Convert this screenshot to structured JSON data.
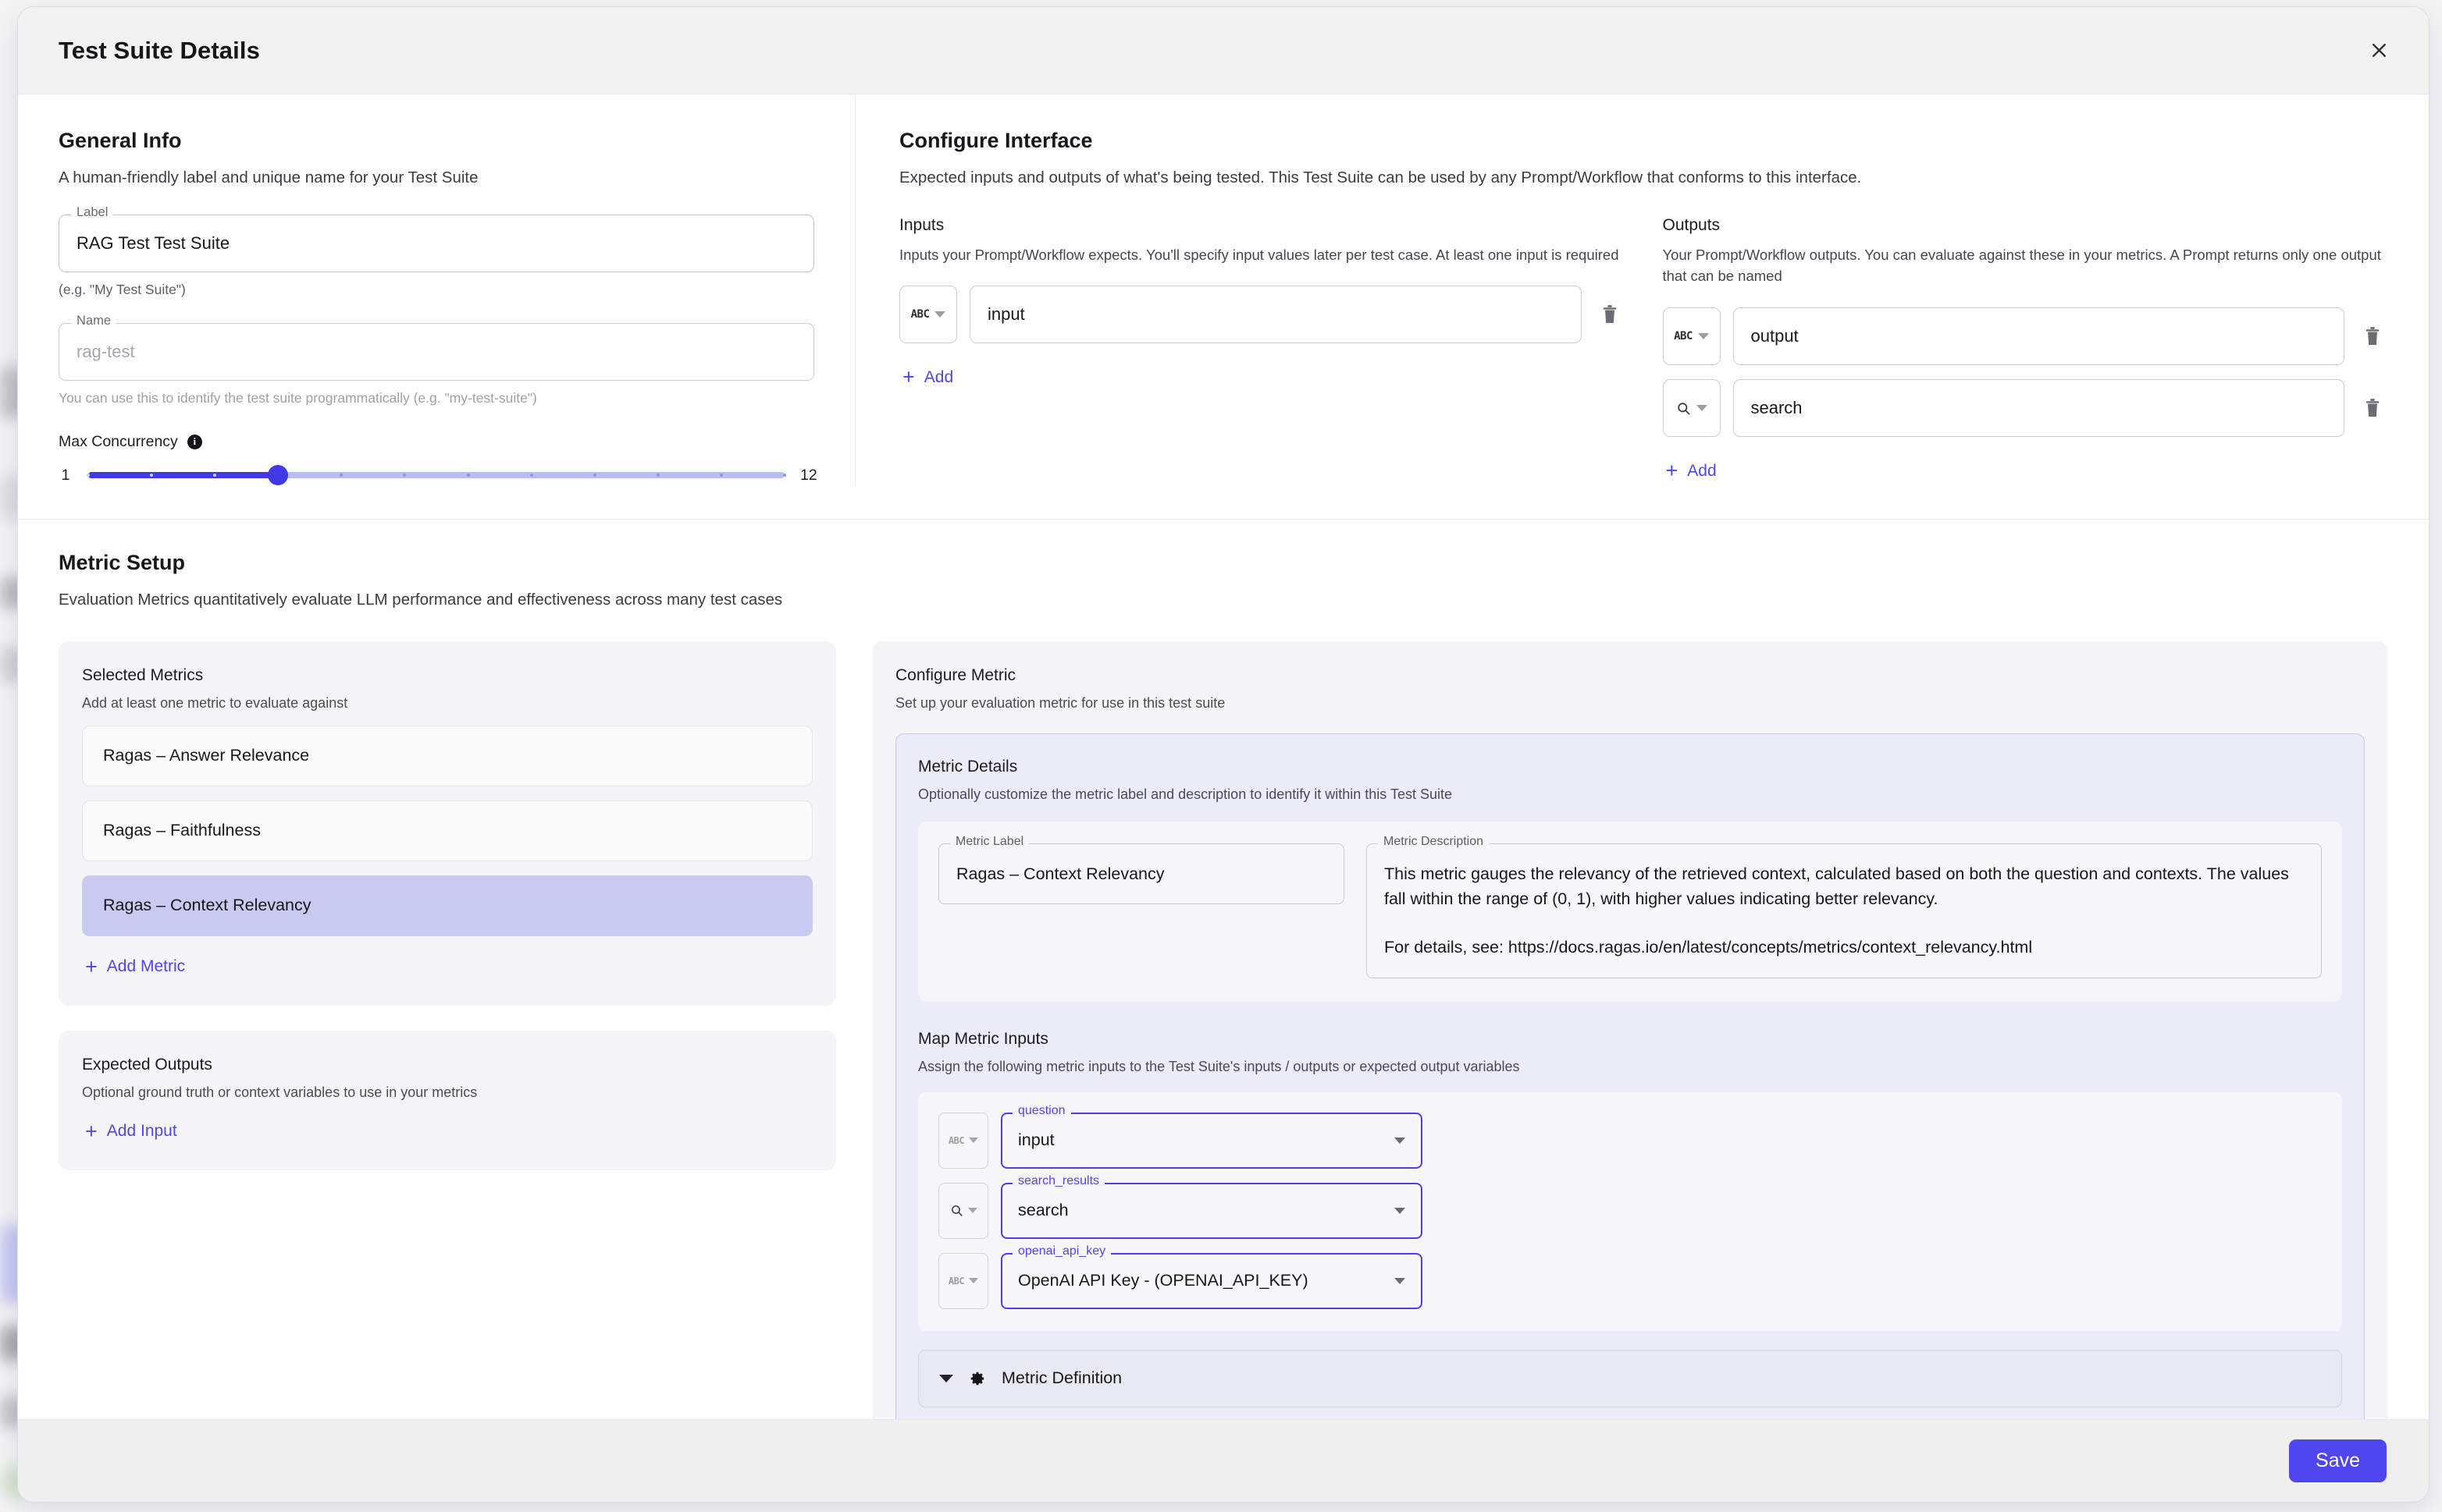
{
  "modal": {
    "title": "Test Suite Details",
    "close_icon": "close-icon",
    "save_label": "Save"
  },
  "general_info": {
    "heading": "General Info",
    "description": "A human-friendly label and unique name for your Test Suite",
    "label_field": {
      "legend": "Label",
      "value": "RAG Test Test Suite",
      "helper": "(e.g. \"My Test Suite\")"
    },
    "name_field": {
      "legend": "Name",
      "placeholder": "rag-test",
      "helper": "You can use this to identify the test suite programmatically (e.g. \"my-test-suite\")"
    },
    "max_concurrency": {
      "label": "Max Concurrency",
      "info_icon": "info-icon",
      "min": 1,
      "max": 12,
      "value": 4,
      "min_label": "1",
      "max_label": "12"
    }
  },
  "configure_interface": {
    "heading": "Configure Interface",
    "description": "Expected inputs and outputs of what's being tested. This Test Suite can be used by any Prompt/Workflow that conforms to this interface.",
    "inputs": {
      "heading": "Inputs",
      "description": "Inputs your Prompt/Workflow expects. You'll specify input values later per test case. At least one input is required",
      "rows": [
        {
          "type_icon": "abc-icon",
          "type_label": "ABC",
          "value": "input",
          "delete_icon": "trash-icon"
        }
      ],
      "add_label": "Add"
    },
    "outputs": {
      "heading": "Outputs",
      "description": "Your Prompt/Workflow outputs. You can evaluate against these in your metrics. A Prompt returns only one output that can be named",
      "rows": [
        {
          "type_icon": "abc-icon",
          "type_label": "ABC",
          "value": "output",
          "delete_icon": "trash-icon"
        },
        {
          "type_icon": "search-icon",
          "type_label": "",
          "value": "search",
          "delete_icon": "trash-icon"
        }
      ],
      "add_label": "Add"
    }
  },
  "metric_setup": {
    "heading": "Metric Setup",
    "description": "Evaluation Metrics quantitatively evaluate LLM performance and effectiveness across many test cases",
    "selected_metrics": {
      "title": "Selected Metrics",
      "subtitle": "Add at least one metric to evaluate against",
      "items": [
        {
          "label": "Ragas – Answer Relevance",
          "selected": false
        },
        {
          "label": "Ragas – Faithfulness",
          "selected": false
        },
        {
          "label": "Ragas – Context Relevancy",
          "selected": true
        }
      ],
      "add_label": "Add Metric"
    },
    "expected_outputs": {
      "title": "Expected Outputs",
      "subtitle": "Optional ground truth or context variables to use in your metrics",
      "add_label": "Add Input"
    },
    "configure_metric": {
      "title": "Configure Metric",
      "subtitle": "Set up your evaluation metric for use in this test suite",
      "metric_details": {
        "title": "Metric Details",
        "subtitle": "Optionally customize the metric label and description to identify it within this Test Suite",
        "metric_label": {
          "legend": "Metric Label",
          "value": "Ragas – Context Relevancy"
        },
        "metric_description": {
          "legend": "Metric Description",
          "paragraph_1": "This metric gauges the relevancy of the retrieved context, calculated based on both the question and contexts. The values fall within the range of (0, 1), with higher values indicating better relevancy.",
          "paragraph_2": "For details, see: https://docs.ragas.io/en/latest/concepts/metrics/context_relevancy.html"
        }
      },
      "map_metric_inputs": {
        "title": "Map Metric Inputs",
        "subtitle": "Assign the following metric inputs to the Test Suite's inputs / outputs or expected output variables",
        "rows": [
          {
            "type_icon": "abc-icon",
            "type_label": "ABC",
            "legend": "question",
            "value": "input"
          },
          {
            "type_icon": "search-icon",
            "type_label": "",
            "legend": "search_results",
            "value": "search"
          },
          {
            "type_icon": "abc-icon",
            "type_label": "ABC",
            "legend": "openai_api_key",
            "value": "OpenAI API Key - (OPENAI_API_KEY)"
          }
        ]
      },
      "metric_definition": {
        "chevron_icon": "chevron-down-icon",
        "gear_icon": "gear-icon",
        "label": "Metric Definition"
      }
    }
  },
  "colors": {
    "accent": "#4f46ed",
    "slider_fill": "#4338e8",
    "slider_track": "#b9bcf6",
    "selected_metric": "#cacaf0",
    "panel_bg": "#ececf8"
  }
}
